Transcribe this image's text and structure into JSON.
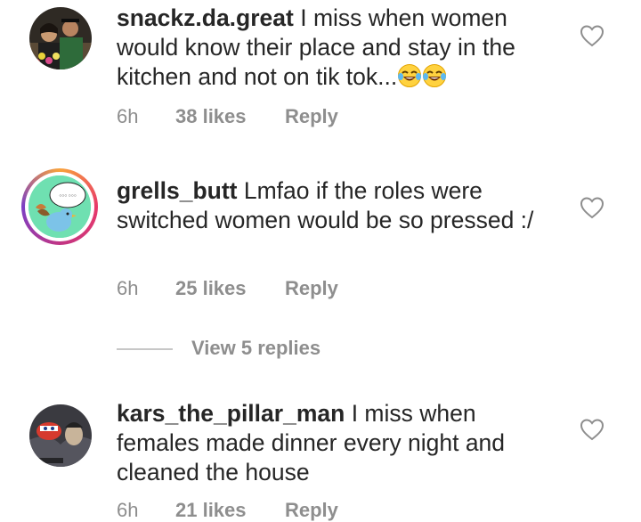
{
  "comments": [
    {
      "username": "snackz.da.great",
      "text": "I miss when women would know their place and stay in the kitchen and not on tik tok...",
      "emoji": [
        "tears-of-joy",
        "tears-of-joy"
      ],
      "time": "6h",
      "likes": "38 likes",
      "reply": "Reply"
    },
    {
      "username": "grells_butt",
      "text": "Lmfao if the roles were switched women would be so pressed :/",
      "time": "6h",
      "likes": "25 likes",
      "reply": "Reply",
      "view_replies": "View 5 replies"
    },
    {
      "username": "kars_the_pillar_man",
      "text": "I miss when females made dinner every night and cleaned the house",
      "time": "6h",
      "likes": "21 likes",
      "reply": "Reply"
    }
  ],
  "colors": {
    "text": "#262626",
    "secondary": "#8e8e8e",
    "story_ring": [
      "#f9a33b",
      "#e8396a",
      "#c13584",
      "#7b3fc5"
    ]
  }
}
